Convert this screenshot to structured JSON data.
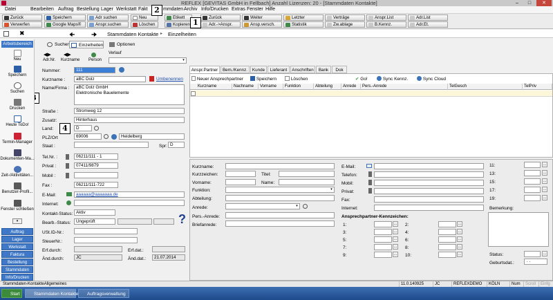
{
  "window": {
    "title": "REFLEX [GEVITAS GmbH in Fellbach] Anzahl Lizenzen: 20 - [Stammdaten Kontakte]"
  },
  "menu": [
    "Datei",
    "Bearbeiten",
    "Auftrag",
    "Bestellung",
    "Lager",
    "Werkstatt",
    "Fakt",
    "mmdaten",
    "Archiv",
    "Info/Drucken",
    "Extras",
    "Fenster",
    "Hilfe"
  ],
  "toolbar": {
    "row1": [
      "Zurück",
      "Speichern",
      "Adr suchen",
      "Neu",
      "Etikett",
      "Zurück",
      "Weiter",
      "Letzter",
      "Verträge",
      "Anspr.List",
      "Adr.List"
    ],
    "row2": [
      "Verwerfen",
      "Google Maps®",
      "Anspr.suchen",
      "Löschen",
      "Kopieren",
      "Adr.->Anspr.",
      "Ansp.versch.",
      "Statistik",
      "Zw.ablage",
      "B.Kennz.",
      "Adr.Et."
    ]
  },
  "badges": [
    "1",
    "2",
    "3",
    "4"
  ],
  "header": {
    "title": "Stammdaten Kontakte",
    "separator": "▸",
    "sub": "Einzelheiten"
  },
  "leftnav": {
    "title": "Arbeitsbereich",
    "items": [
      "Neu",
      "Speichern",
      "Suchen",
      "Drucken",
      "Heute ToDo!",
      "Termin-Manager",
      "Dokumenten-Ma...",
      "Zeit-/Aktivitäten...",
      "Benutzer-Profil...",
      "Fenster schließen"
    ],
    "buttons": [
      "Auftrag",
      "Lager",
      "Werkstatt",
      "Faktura",
      "Bestellung",
      "Stammdaten",
      "Info/Drucken"
    ]
  },
  "tabs": [
    "Suchen",
    "Einzelheiten",
    "Optionen"
  ],
  "nav_icons": [
    "Adr.Nr.",
    "Kurzname",
    "Person",
    "Verlauf"
  ],
  "form": {
    "nummer_label": "Nummer:",
    "nummer": "111",
    "kurzname_label": "Kurzname :",
    "kurzname": "aBC Dolz",
    "umbenennen": "Umbenennen",
    "name_label": "Name/Firma :",
    "name1": "aBC Dolz GmbH",
    "name2": "Elektronische Bauelemente",
    "strasse_label": "Straße :",
    "strasse": "Stromweg 12",
    "zusatz_label": "Zusatz:",
    "zusatz": "Hinterhaus",
    "land_label": "Land:",
    "land": "D",
    "plz_label": "PLZ/Ort",
    "plz": "69006",
    "ort": "Heidelberg",
    "staat_label": "Staat :",
    "spr_label": "Spr:",
    "spr": "D",
    "tel_label": "Tel.Nr. :",
    "tel": "06211/111 - 1",
    "privat_label": "Privat :",
    "privat": "07411/9879",
    "mobil_label": "Mobil :",
    "fax_label": "Fax :",
    "fax": "06211/111-722",
    "email_label": "E-Mail:",
    "email": "aaaaaa@aaaaaaa.de",
    "internet_label": "Internet:",
    "kontakt_label": "Kontakt-Status:",
    "kontakt": "Aktiv",
    "bearb_label": "Bearb.-Status:",
    "bearb": "Ungeprüft",
    "ust_label": "USt.ID-Nr.:",
    "steuer_label": "SteuerNr.:",
    "erf_label": "Erf.durch:",
    "erfdat_label": "Erf.dat.:",
    "aend_label": "Änd.durch:",
    "aend": "JC",
    "aenddat_label": "Änd.dat.:",
    "aenddat": "21.07.2014"
  },
  "right_tabs": [
    "Anspr.Partner",
    "Bem./Kennz.",
    "Kunde",
    "Lieferant",
    "Anschriften",
    "Bank",
    "Dok"
  ],
  "right_toolbar": [
    "Neuer Ansprechpartner",
    "Speichern",
    "Löschen",
    "Go!",
    "Sync Kennz.",
    "Sync Cloud"
  ],
  "columns": [
    "Kurzname",
    "Nachname",
    "Vorname",
    "Funktion",
    "Abteilung",
    "Anrede",
    "Pers.-Anrede",
    "TelGesch",
    "TelPriv"
  ],
  "contact_form": {
    "left": [
      "Kurzname:",
      "Kurzzeichen:",
      "Vorname:",
      "Funktion:",
      "Abteilung:",
      "Anrede:",
      "Pers.-Anrede:",
      "Briefanrede:"
    ],
    "titel": "Titel:",
    "name": "Name:",
    "mid": [
      "E-Mail:",
      "Telefon:",
      "Mobil:",
      "Privat:",
      "Fax:",
      "Internet:"
    ],
    "kennz_title": "Ansprechpartner-Kennzeichen:",
    "kennz": [
      "1:",
      "2:",
      "3:",
      "4:",
      "5:",
      "6:",
      "7:",
      "8:",
      "9:",
      "10:"
    ],
    "right": [
      "11:",
      "13:",
      "15:",
      "17:",
      "19:"
    ],
    "bemerkung": "Bemerkung:",
    "status": "Status:",
    "geburtsdat": "Geburtsdat.:",
    "geburtsdat_value": ". ."
  },
  "statusbar": {
    "left": "Stammdaten-KontakteAllgemeines",
    "version": "11.0.140925",
    "user": "JC",
    "db": "REFLEXDEMO",
    "city": "KÖLN",
    "flags": [
      "Num",
      "Scroll",
      "Einfg"
    ]
  },
  "taskbar": {
    "start": "Start",
    "tasks": [
      "Stammdaten Kontakte",
      "Auftragsverwaltung"
    ]
  },
  "colors": {
    "accent": "#3e78c6",
    "taskbar": "#1d4a8a"
  }
}
